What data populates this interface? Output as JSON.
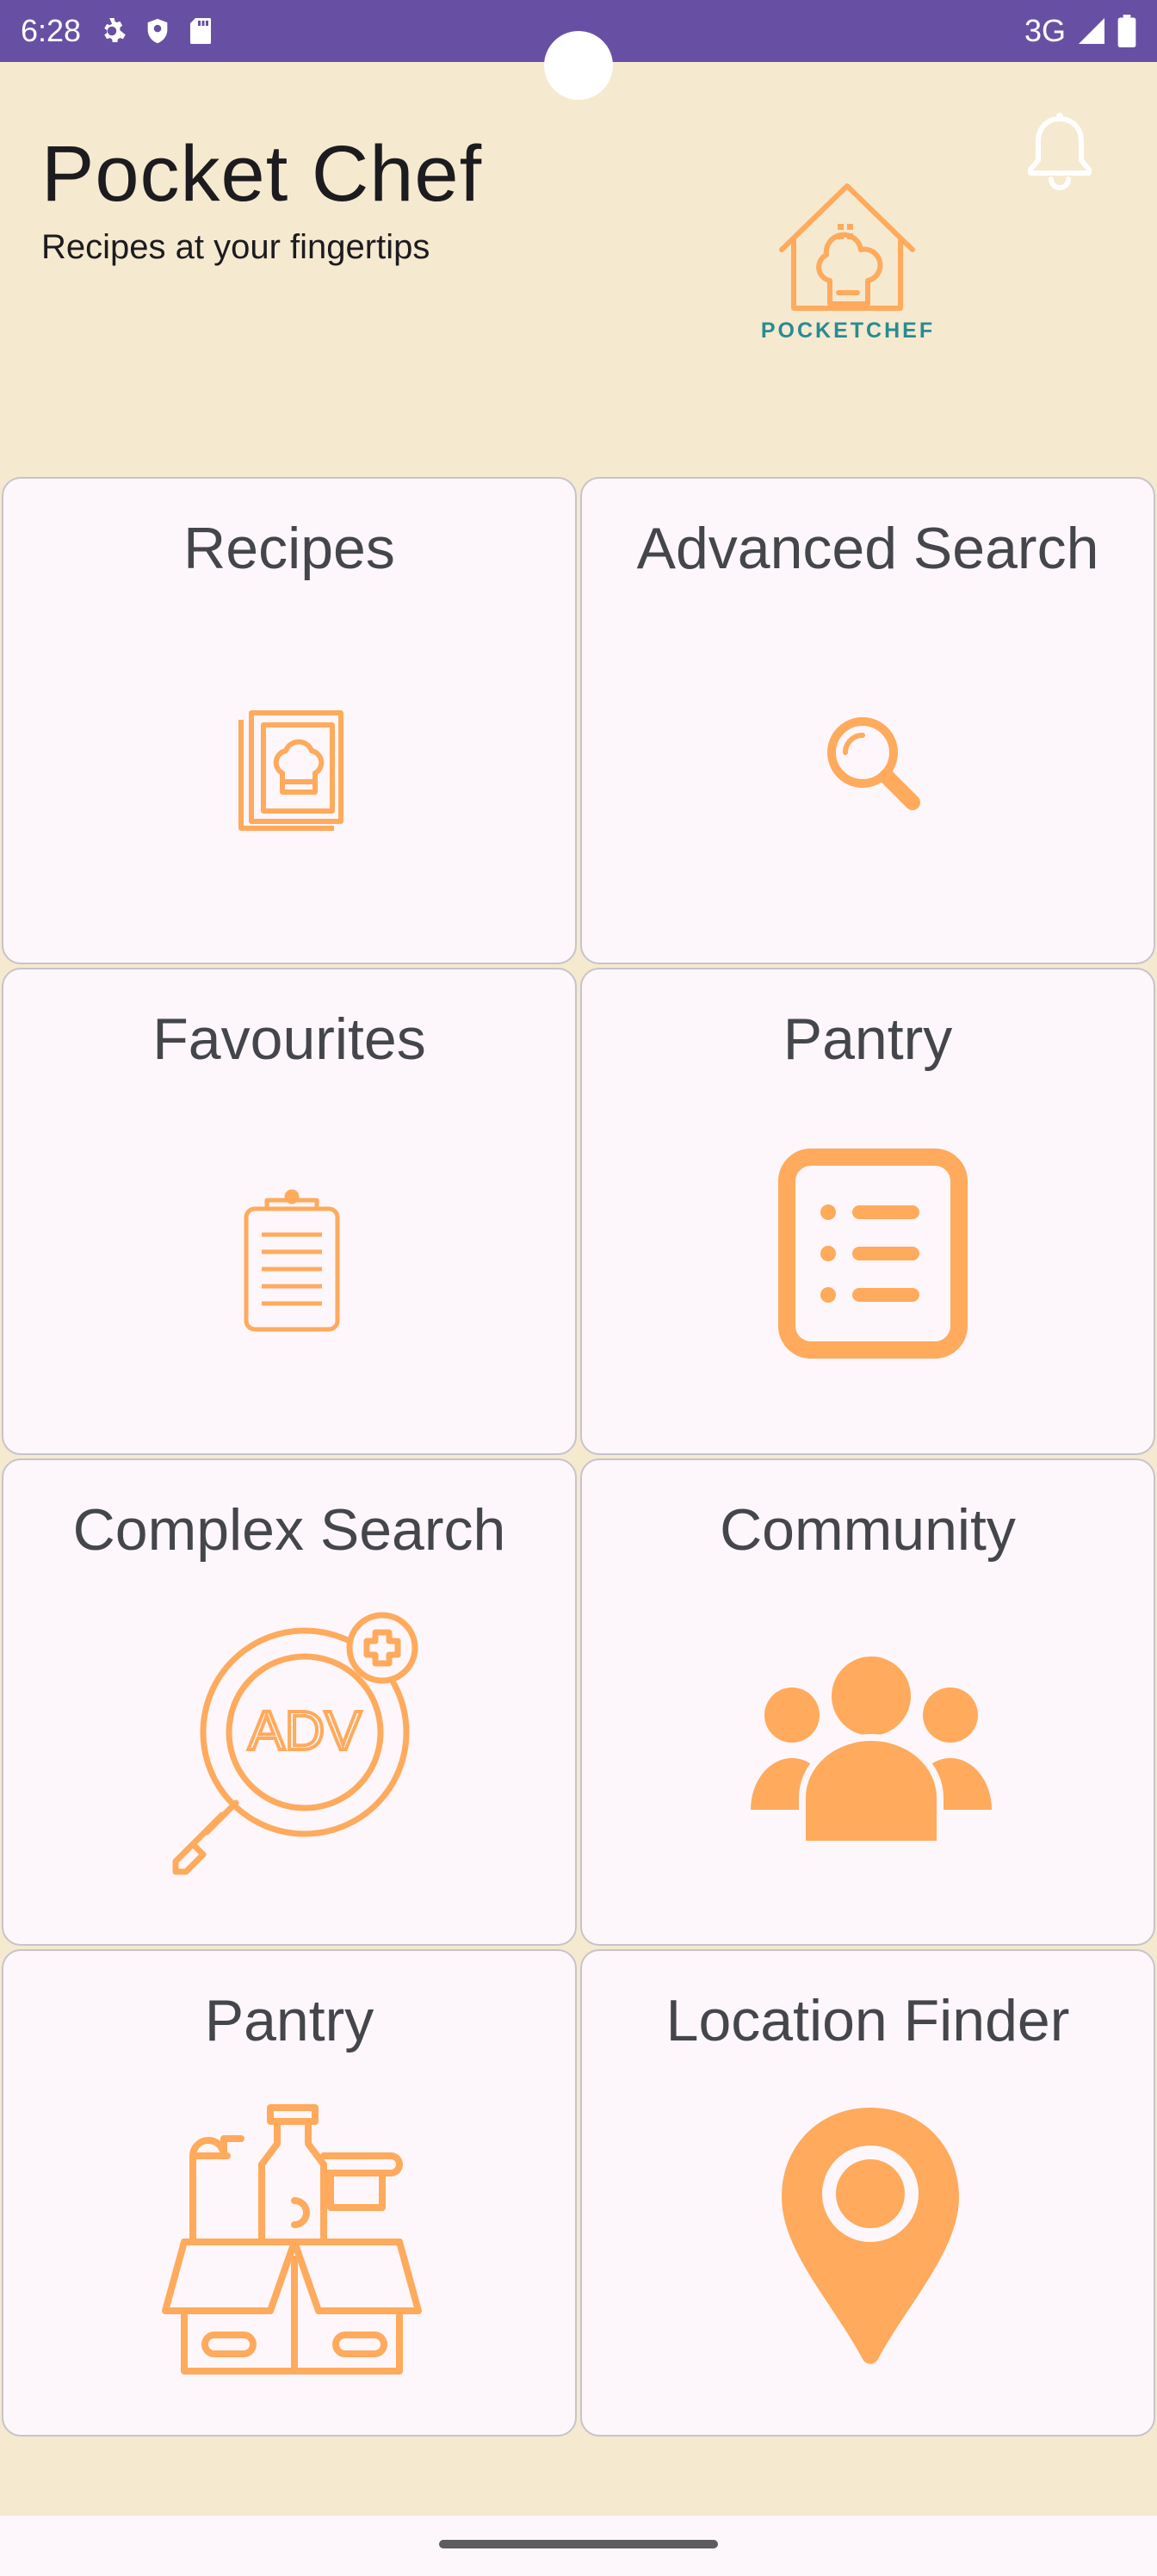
{
  "status_bar": {
    "time": "6:28",
    "network": "3G",
    "icons": [
      "settings-icon",
      "shield-icon",
      "sd-card-icon",
      "signal-icon",
      "battery-icon"
    ]
  },
  "header": {
    "title": "Pocket Chef",
    "subtitle": "Recipes at your fingertips",
    "logo_text": "POCKETCHEF",
    "notification_icon": "bell-icon"
  },
  "tiles": [
    {
      "label": "Recipes",
      "icon": "chef-book-icon"
    },
    {
      "label": "Advanced Search",
      "icon": "magnifier-icon"
    },
    {
      "label": "Favourites",
      "icon": "clipboard-icon"
    },
    {
      "label": "Pantry",
      "icon": "list-icon"
    },
    {
      "label": "Complex Search",
      "icon": "adv-search-icon"
    },
    {
      "label": "Community",
      "icon": "people-icon"
    },
    {
      "label": "Pantry",
      "icon": "grocery-box-icon"
    },
    {
      "label": "Location Finder",
      "icon": "location-pin-icon"
    }
  ],
  "colors": {
    "status_bar": "#6750a4",
    "background": "#f5e9d0",
    "tile_background": "#fdf7fc",
    "accent": "#ffaa5c",
    "logo_text": "#2a8a92"
  }
}
